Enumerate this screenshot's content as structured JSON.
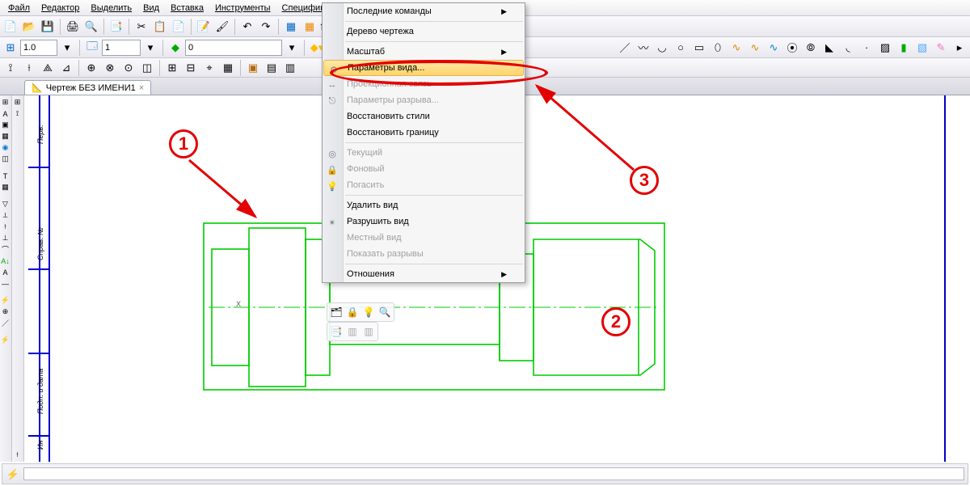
{
  "menubar": {
    "file": "Файл",
    "editor": "Редактор",
    "select": "Выделить",
    "view": "Вид",
    "insert": "Вставка",
    "tools": "Инструменты",
    "spec": "Спецификация"
  },
  "doctab": {
    "title": "Чертеж БЕЗ ИМЕНИ1"
  },
  "toolbar2": {
    "scale": "1.0",
    "state_num": "1",
    "value_0": "0"
  },
  "context_menu": {
    "recent": "Последние команды",
    "tree": "Дерево чертежа",
    "scale": "Масштаб",
    "view_params": "Параметры вида...",
    "proj_link": "Проекционная связь",
    "break_params": "Параметры разрыва...",
    "restore_styles": "Восстановить стили",
    "restore_bounds": "Восстановить границу",
    "current": "Текущий",
    "background": "Фоновый",
    "hide": "Погасить",
    "delete_view": "Удалить вид",
    "destroy_view": "Разрушить вид",
    "local_view": "Местный вид",
    "show_breaks": "Показать разрывы",
    "relations": "Отношения"
  },
  "titleblock": {
    "row1": "Перв. ",
    "row2": "Справ. №",
    "row3": "Подп. и дата",
    "row4": "Ин "
  },
  "canvas_marker": "X",
  "annotations": {
    "n1": "1",
    "n2": "2",
    "n3": "3"
  }
}
